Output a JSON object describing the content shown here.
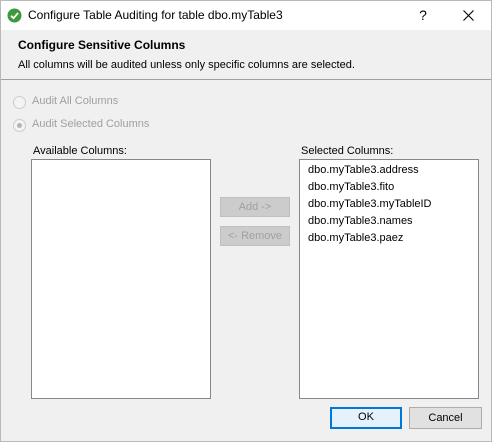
{
  "window": {
    "title": "Configure Table Auditing for table dbo.myTable3",
    "help_label": "?",
    "app_icon": "green-check-circle-icon",
    "close_icon": "close-icon"
  },
  "header": {
    "title": "Configure Sensitive Columns",
    "description": "All columns will be audited unless only specific columns are selected."
  },
  "radios": [
    {
      "label": "Audit All Columns",
      "checked": false,
      "enabled": false
    },
    {
      "label": "Audit Selected Columns",
      "checked": true,
      "enabled": false
    }
  ],
  "available": {
    "label": "Available Columns:",
    "items": []
  },
  "selected": {
    "label": "Selected Columns:",
    "items": [
      "dbo.myTable3.address",
      "dbo.myTable3.fito",
      "dbo.myTable3.myTableID",
      "dbo.myTable3.names",
      "dbo.myTable3.paez"
    ]
  },
  "actions": {
    "add_label": "Add ->",
    "remove_label": "<- Remove"
  },
  "footer": {
    "ok_label": "OK",
    "cancel_label": "Cancel"
  },
  "colors": {
    "accent": "#0078d7",
    "check_green": "#3c9a3c"
  }
}
